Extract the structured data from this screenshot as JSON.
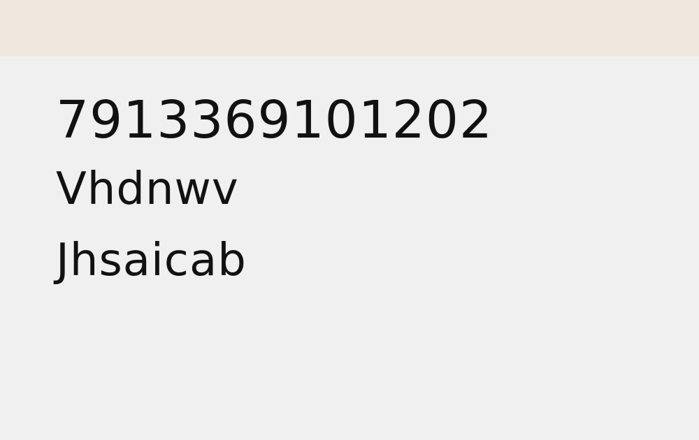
{
  "header": {
    "background_color": "#f0e7df"
  },
  "content": {
    "number_line": "7913369101202",
    "line_two": "Vhdnwv",
    "line_three": "Jhsaicab"
  },
  "colors": {
    "page_background": "#f0f0f0",
    "text": "#111111"
  }
}
